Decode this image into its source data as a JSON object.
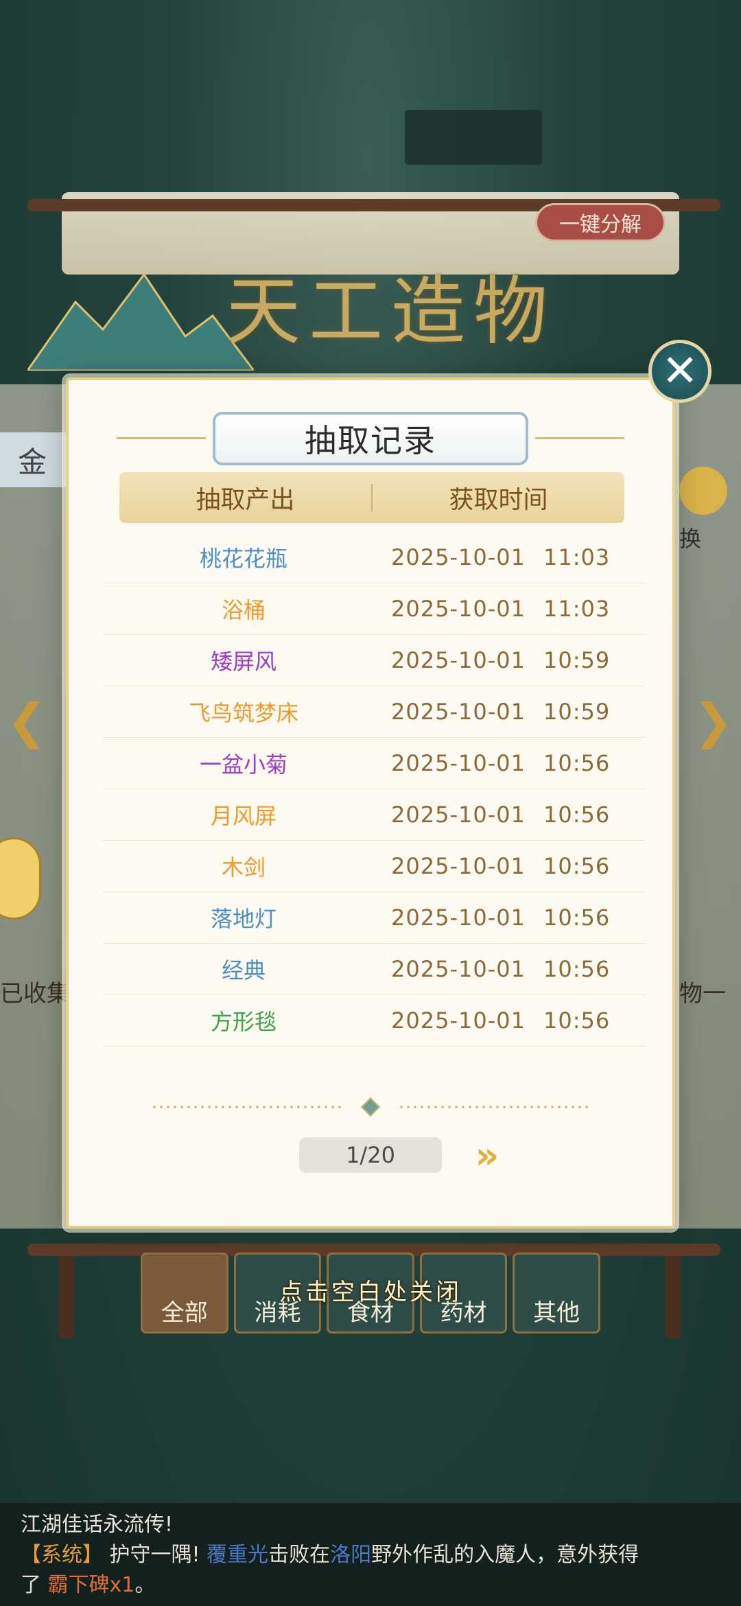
{
  "background": {
    "decompose_button": "一键分解",
    "title_art": "天工造物",
    "side_tab_text": "金",
    "collected_label": "已收集",
    "overview_label": "物一览",
    "exchange_label": "换"
  },
  "bottom_tabs": [
    {
      "label": "全部",
      "active": true
    },
    {
      "label": "消耗",
      "active": false
    },
    {
      "label": "食材",
      "active": false
    },
    {
      "label": "药材",
      "active": false
    },
    {
      "label": "其他",
      "active": false
    }
  ],
  "close_hint": "点击空白处关闭",
  "modal": {
    "title": "抽取记录",
    "columns": [
      "抽取产出",
      "获取时间"
    ],
    "rows": [
      {
        "name": "桃花花瓶",
        "date": "2025-10-01",
        "time": "11:03",
        "color": "#4d8fc7"
      },
      {
        "name": "浴桶",
        "date": "2025-10-01",
        "time": "11:03",
        "color": "#ee9a2e"
      },
      {
        "name": "矮屏风",
        "date": "2025-10-01",
        "time": "10:59",
        "color": "#9a3fc4"
      },
      {
        "name": "飞鸟筑梦床",
        "date": "2025-10-01",
        "time": "10:59",
        "color": "#ee9a2e"
      },
      {
        "name": "一盆小菊",
        "date": "2025-10-01",
        "time": "10:56",
        "color": "#9a3fc4"
      },
      {
        "name": "月风屏",
        "date": "2025-10-01",
        "time": "10:56",
        "color": "#ee9a2e"
      },
      {
        "name": "木剑",
        "date": "2025-10-01",
        "time": "10:56",
        "color": "#ee9a2e"
      },
      {
        "name": "落地灯",
        "date": "2025-10-01",
        "time": "10:56",
        "color": "#4d8fc7"
      },
      {
        "name": "经典",
        "date": "2025-10-01",
        "time": "10:56",
        "color": "#4d8fc7"
      },
      {
        "name": "方形毯",
        "date": "2025-10-01",
        "time": "10:56",
        "color": "#3fa14b"
      }
    ],
    "page": "1/20",
    "next_icon": "double-chevron-right-icon",
    "close_icon": "close-x-icon"
  },
  "chat": {
    "line1": "江湖佳话永流传!",
    "sys_tag": "【系统】",
    "text_a": "护守一隅!",
    "player": "覆重光",
    "text_b": "击败在",
    "place": "洛阳",
    "text_c": "野外作乱的入魔人，意外获得",
    "text_d": "了",
    "item": "霸下碑x1",
    "text_e": "。"
  }
}
